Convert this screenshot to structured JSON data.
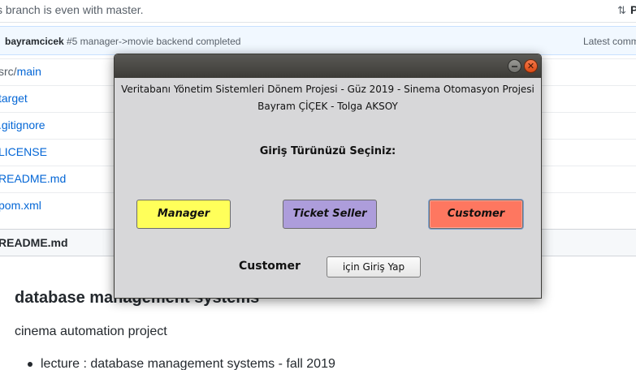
{
  "github": {
    "branch_status": "s branch is even with master.",
    "pr_label": "P",
    "commit": {
      "author": "bayramcicek",
      "message": "#5 manager->movie backend completed",
      "latest": "Latest comm"
    },
    "files": [
      {
        "dir": "src/",
        "name": "main"
      },
      {
        "dir": "",
        "name": "target"
      },
      {
        "dir": "",
        "name": ".gitignore"
      },
      {
        "dir": "",
        "name": "LICENSE"
      },
      {
        "dir": "",
        "name": "README.md"
      },
      {
        "dir": "",
        "name": "pom.xml"
      }
    ],
    "readme_header": "README.md",
    "readme": {
      "title": "database management systems",
      "subtitle": "cinema automation project",
      "list_item": "lecture : database management systems - fall 2019"
    }
  },
  "dialog": {
    "close_glyph": "✕",
    "header_line1": "Veritabanı Yönetim Sistemleri Dönem Projesi - Güz 2019 - Sinema Otomasyon Projesi",
    "header_line2": "Bayram ÇİÇEK - Tolga AKSOY",
    "prompt": "Giriş Türünüzü Seçiniz:",
    "roles": {
      "manager": "Manager",
      "ticket_seller": "Ticket Seller",
      "customer": "Customer"
    },
    "selected_role": "Customer",
    "login_button": "için Giriş Yap",
    "colors": {
      "manager": "#ffff5a",
      "ticket_seller": "#ad9ddb",
      "customer": "#fe7760"
    }
  }
}
